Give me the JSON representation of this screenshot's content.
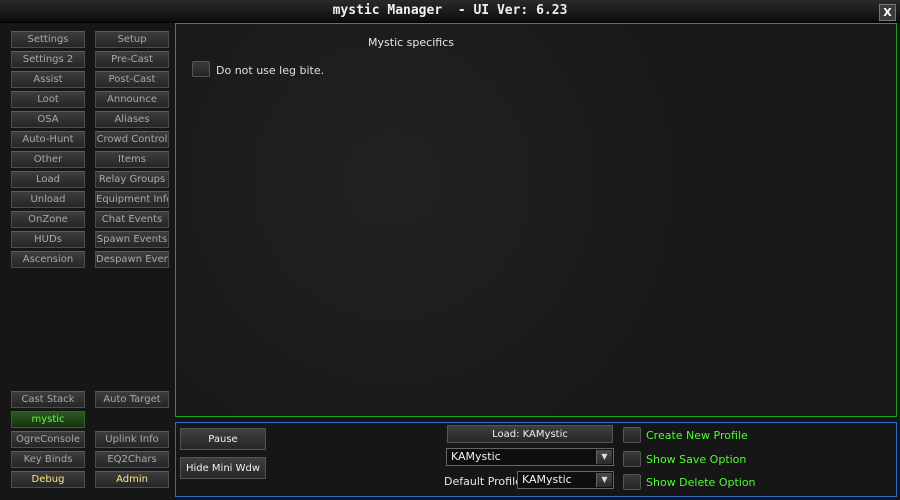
{
  "window": {
    "title": "mystic Manager  - UI Ver: 6.23",
    "close_label": "X"
  },
  "nav_left": [
    "Settings",
    "Settings 2",
    "Assist",
    "Loot",
    "OSA",
    "Auto-Hunt",
    "Other",
    "Load",
    "Unload",
    "OnZone",
    "HUDs",
    "Ascension"
  ],
  "nav_right": [
    "Setup",
    "Pre-Cast",
    "Post-Cast",
    "Announce",
    "Aliases",
    "Crowd Control",
    "Items",
    "Relay Groups",
    "Equipment Info",
    "Chat Events",
    "Spawn Events",
    "Despawn Event"
  ],
  "bottom_nav": {
    "cast_stack": "Cast Stack",
    "auto_target": "Auto Target",
    "mystic": "mystic",
    "ogre_console": "OgreConsole",
    "uplink_info": "Uplink Info",
    "key_binds": "Key Binds",
    "eq2chars": "EQ2Chars",
    "debug": "Debug",
    "admin": "Admin"
  },
  "panel": {
    "title": "Mystic specifics",
    "options": [
      {
        "label": "Do not use leg bite.",
        "checked": false
      }
    ]
  },
  "footer": {
    "pause": "Pause",
    "hide_mini": "Hide Mini Wdw",
    "load_button": "Load: KAMystic",
    "profile_select": "KAMystic",
    "default_profile_label": "Default Profile:",
    "default_profile_select": "KAMystic",
    "create_new_profile": "Create New Profile",
    "show_save_option": "Show Save Option",
    "show_delete_option": "Show Delete Option"
  },
  "colors": {
    "active_green": "#4cff2e",
    "panel_border": "#22a022",
    "footer_border": "#2f6cc8",
    "highlight_yellow": "#ffe67a"
  }
}
